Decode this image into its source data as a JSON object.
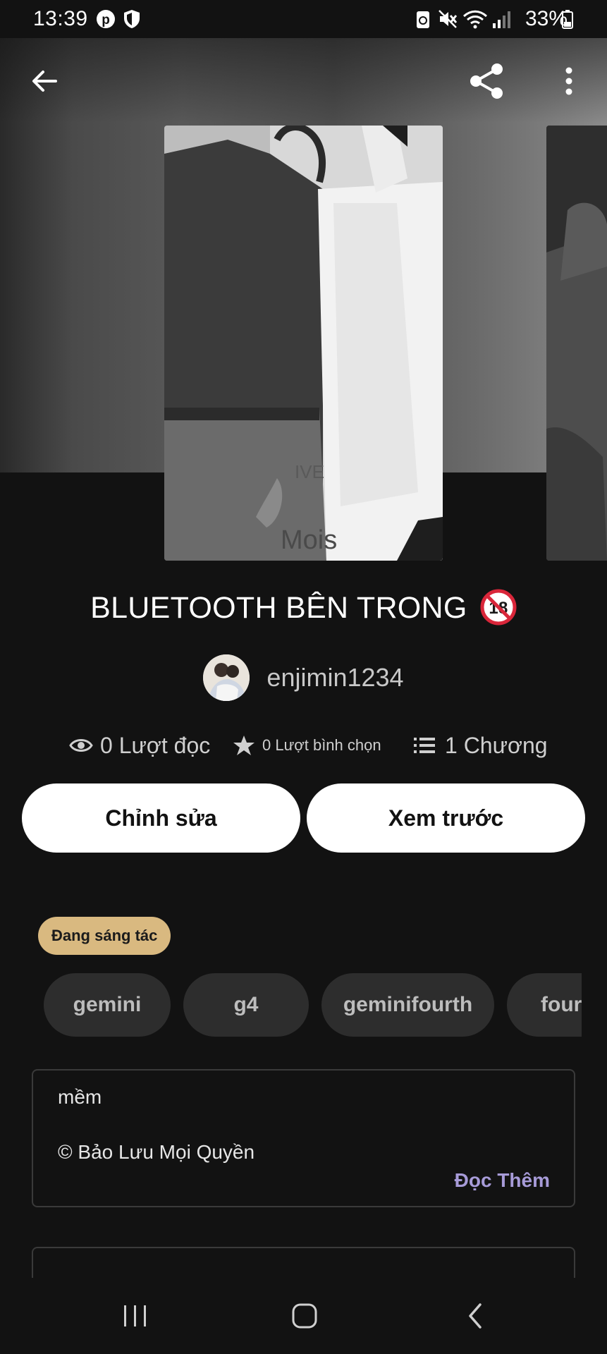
{
  "status_bar": {
    "time": "13:39",
    "battery": "33%",
    "icons": [
      "pinterest-icon",
      "shield-icon",
      "recycle-icon",
      "mute-icon",
      "wifi-icon",
      "signal-icon",
      "battery-icon"
    ]
  },
  "toolbar": {
    "icons": [
      "back-arrow-icon",
      "share-icon",
      "more-vert-icon"
    ]
  },
  "story": {
    "title": "BLUETOOTH BÊN TRONG",
    "rating_badge": "18",
    "author": "enjimin1234",
    "stats": {
      "reads": "0 Lượt đọc",
      "votes": "0 Lượt bình chọn",
      "chapters": "1 Chương"
    }
  },
  "actions": {
    "edit_label": "Chỉnh sửa",
    "preview_label": "Xem trước"
  },
  "status_label": "Đang sáng tác",
  "tags": [
    "gemini",
    "g4",
    "geminifourth",
    "fourth"
  ],
  "description": {
    "line1": "mềm",
    "line2": "© Bảo Lưu Mọi Quyền",
    "read_more": "Đọc Thêm"
  },
  "colors": {
    "background": "#121212",
    "status_pill": "#d9b980",
    "read_more": "#a79bd8",
    "tag_bg": "#2d2d2d"
  }
}
